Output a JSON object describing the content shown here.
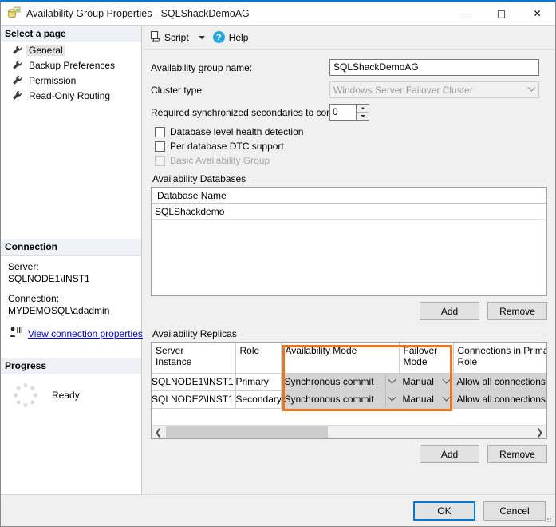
{
  "window": {
    "title": "Availability Group Properties - SQLShackDemoAG",
    "icon": "availability-group-icon",
    "controls": {
      "minimize": "—",
      "maximize": "□",
      "close": "✕"
    }
  },
  "sidebar": {
    "header": "Select a page",
    "items": [
      {
        "label": "General",
        "selected": true
      },
      {
        "label": "Backup Preferences",
        "selected": false
      },
      {
        "label": "Permission",
        "selected": false
      },
      {
        "label": "Read-Only Routing",
        "selected": false
      }
    ],
    "connection": {
      "header": "Connection",
      "server_label": "Server:",
      "server_value": "SQLNODE1\\INST1",
      "connection_label": "Connection:",
      "connection_value": "MYDEMOSQL\\adadmin",
      "view_properties_link": "View connection properties"
    },
    "progress": {
      "header": "Progress",
      "status": "Ready"
    }
  },
  "toolbar": {
    "script_label": "Script",
    "help_label": "Help"
  },
  "form": {
    "ag_name_label": "Availability group name:",
    "ag_name_value": "SQLShackDemoAG",
    "cluster_type_label": "Cluster type:",
    "cluster_type_value": "Windows Server Failover Cluster",
    "required_sync_label": "Required synchronized secondaries to commit:",
    "required_sync_value": "0",
    "checkboxes": [
      {
        "label": "Database level health detection",
        "checked": false,
        "disabled": false
      },
      {
        "label": "Per database DTC support",
        "checked": false,
        "disabled": false
      },
      {
        "label": "Basic Availability Group",
        "checked": false,
        "disabled": true
      }
    ]
  },
  "databases": {
    "group_title": "Availability Databases",
    "column_header": "Database Name",
    "rows": [
      "SQLShackdemo"
    ],
    "add_label": "Add",
    "remove_label": "Remove"
  },
  "replicas": {
    "group_title": "Availability Replicas",
    "columns": [
      "Server\nInstance",
      "Role",
      "Availability Mode",
      "Failover\nMode",
      "Connections in Primary\nRole"
    ],
    "columns_flat": [
      "Server Instance",
      "Role",
      "Availability Mode",
      "Failover Mode",
      "Connections in Primary Role"
    ],
    "rows": [
      {
        "server_instance": "SQLNODE1\\INST1",
        "role": "Primary",
        "availability_mode": "Synchronous commit",
        "failover_mode": "Manual",
        "connections_primary_role": "Allow all connections"
      },
      {
        "server_instance": "SQLNODE2\\INST1",
        "role": "Secondary",
        "availability_mode": "Synchronous commit",
        "failover_mode": "Manual",
        "connections_primary_role": "Allow all connections"
      }
    ],
    "add_label": "Add",
    "remove_label": "Remove",
    "highlight_color": "#f07519"
  },
  "footer": {
    "ok_label": "OK",
    "cancel_label": "Cancel"
  }
}
